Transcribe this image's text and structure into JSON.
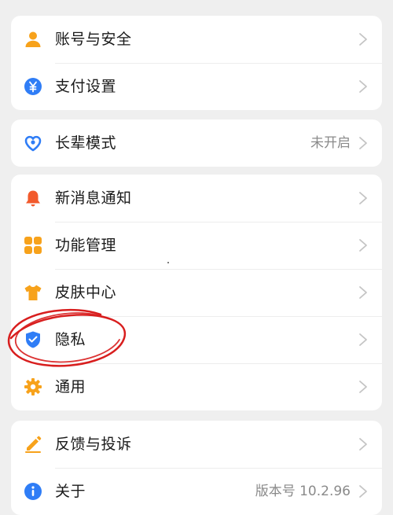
{
  "groups": [
    {
      "items": [
        {
          "label": "账号与安全",
          "icon": "user-icon",
          "value": ""
        },
        {
          "label": "支付设置",
          "icon": "yuan-icon",
          "value": ""
        }
      ]
    },
    {
      "items": [
        {
          "label": "长辈模式",
          "icon": "heart-icon",
          "value": "未开启"
        }
      ]
    },
    {
      "items": [
        {
          "label": "新消息通知",
          "icon": "bell-icon",
          "value": ""
        },
        {
          "label": "功能管理",
          "icon": "grid-icon",
          "value": ""
        },
        {
          "label": "皮肤中心",
          "icon": "shirt-icon",
          "value": ""
        },
        {
          "label": "隐私",
          "icon": "shield-icon",
          "value": ""
        },
        {
          "label": "通用",
          "icon": "gear-icon",
          "value": ""
        }
      ]
    },
    {
      "items": [
        {
          "label": "反馈与投诉",
          "icon": "pencil-icon",
          "value": ""
        },
        {
          "label": "关于",
          "icon": "info-icon",
          "value": "版本号 10.2.96"
        }
      ]
    }
  ],
  "colors": {
    "background": "#efefef",
    "card": "#ffffff",
    "orange": "#f7a21b",
    "blue": "#2f7df6",
    "red_bell": "#f25a2c",
    "annotation_red": "#d81e1e",
    "secondary_text": "#8a8a8a",
    "chevron": "#c4c4c4"
  }
}
